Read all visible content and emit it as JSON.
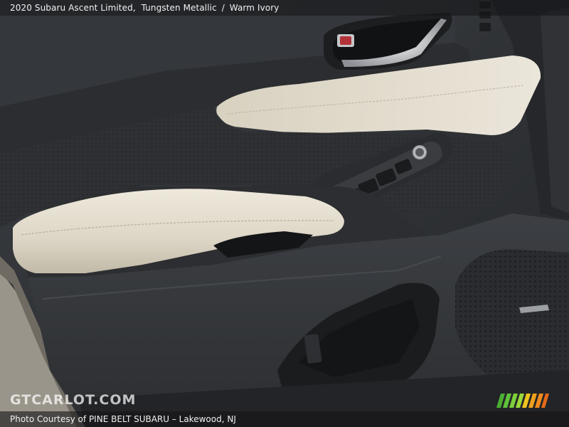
{
  "caption": {
    "vehicle": "2020 Subaru Ascent Limited,",
    "exterior_color": "Tungsten Metallic",
    "separator": "/",
    "interior_color": "Warm Ivory"
  },
  "watermark": "GTCARLOT.COM",
  "credit": "Photo Courtesy of PINE BELT SUBARU – Lakewood, NJ",
  "colors": {
    "trim_ivory": "#ddd6c6",
    "panel_dark": "#33363a",
    "badge_green": "#5fc23a",
    "badge_orange": "#f08a1e"
  }
}
